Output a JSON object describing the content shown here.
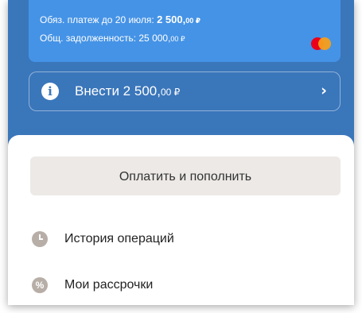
{
  "card": {
    "payment_prefix": "Обяз. платеж до 20 июля: ",
    "payment_amount_main": "2 500,",
    "payment_amount_cents": "00 ₽",
    "debt_prefix": "Общ. задолженность: 25 000,",
    "debt_cents": "00 ₽",
    "payment_system_icon": "mastercard-logo"
  },
  "pay_row": {
    "icon": "info-icon",
    "label_main": "Внести 2 500,",
    "label_cents": "00 ₽",
    "chevron_icon": "chevron-right-icon"
  },
  "main_button_label": "Оплатить и пополнить",
  "menu": [
    {
      "icon": "clock-icon",
      "label": "История операций"
    },
    {
      "icon": "percent-icon",
      "label": "Мои рассрочки"
    }
  ],
  "colors": {
    "header_bg": "#3a76ba",
    "card_bg": "#4593e6",
    "button_bg": "#ece9e6",
    "menu_icon": "#b7aea7"
  }
}
